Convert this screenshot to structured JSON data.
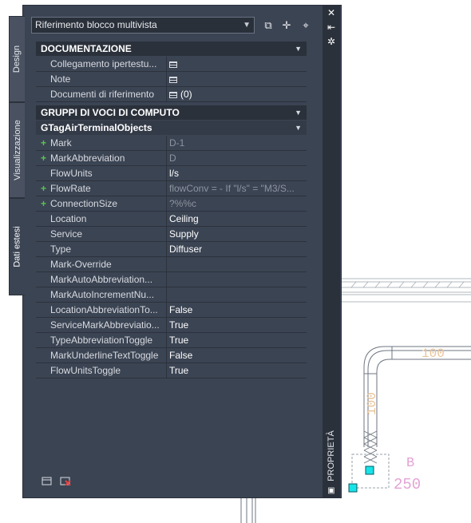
{
  "palette": {
    "tabs": [
      "Design",
      "Visualizzazione",
      "Dati estesi"
    ],
    "active_tab": "Dati estesi",
    "title": "PROPRIETÀ",
    "dropdown_value": "Riferimento blocco multivista"
  },
  "sections": {
    "documentazione": {
      "title": "DOCUMENTAZIONE",
      "rows": [
        {
          "name": "Collegamento  ipertestu...",
          "value": ""
        },
        {
          "name": "Note",
          "value": ""
        },
        {
          "name": "Documenti di riferimento",
          "value": "(0)"
        }
      ]
    },
    "gruppi": {
      "title": "GRUPPI DI VOCI DI COMPUTO",
      "subtitle": "GTagAirTerminalObjects",
      "rows": [
        {
          "name": "Mark",
          "value": "D-1"
        },
        {
          "name": "MarkAbbreviation",
          "value": "D"
        },
        {
          "name": "FlowUnits",
          "value": "l/s"
        },
        {
          "name": "FlowRate",
          "value": "flowConv = - If \"l/s\" = \"M3/S..."
        },
        {
          "name": "ConnectionSize",
          "value": "?%%c"
        },
        {
          "name": "Location",
          "value": "Ceiling"
        },
        {
          "name": "Service",
          "value": "Supply"
        },
        {
          "name": "Type",
          "value": "Diffuser"
        },
        {
          "name": "Mark-Override",
          "value": ""
        },
        {
          "name": "MarkAutoAbbreviation...",
          "value": ""
        },
        {
          "name": "MarkAutoIncrementNu...",
          "value": ""
        },
        {
          "name": "LocationAbbreviationTo...",
          "value": "False"
        },
        {
          "name": "ServiceMarkAbbreviatio...",
          "value": "True"
        },
        {
          "name": "TypeAbbreviationToggle",
          "value": "True"
        },
        {
          "name": "MarkUnderlineTextToggle",
          "value": "False"
        },
        {
          "name": "FlowUnitsToggle",
          "value": "True"
        }
      ]
    }
  },
  "drawing": {
    "dim_1": "100",
    "dim_2": "100",
    "tag_letter": "B",
    "tag_value": "250"
  },
  "colors": {
    "palette_bg": "#3b4453",
    "header_bg": "#2b313b",
    "plus_green": "#59c44c",
    "duct_tag": "#e3a3d6",
    "dim_orange": "#e8c49a",
    "grip_cyan": "#18e3e8"
  },
  "icons": {
    "quick_select": "quick-select-icon",
    "pick_add": "pick-add-icon",
    "select_objects": "select-objects-icon",
    "close": "close-icon",
    "auto_hide": "auto-hide-icon",
    "settings": "settings-icon"
  }
}
